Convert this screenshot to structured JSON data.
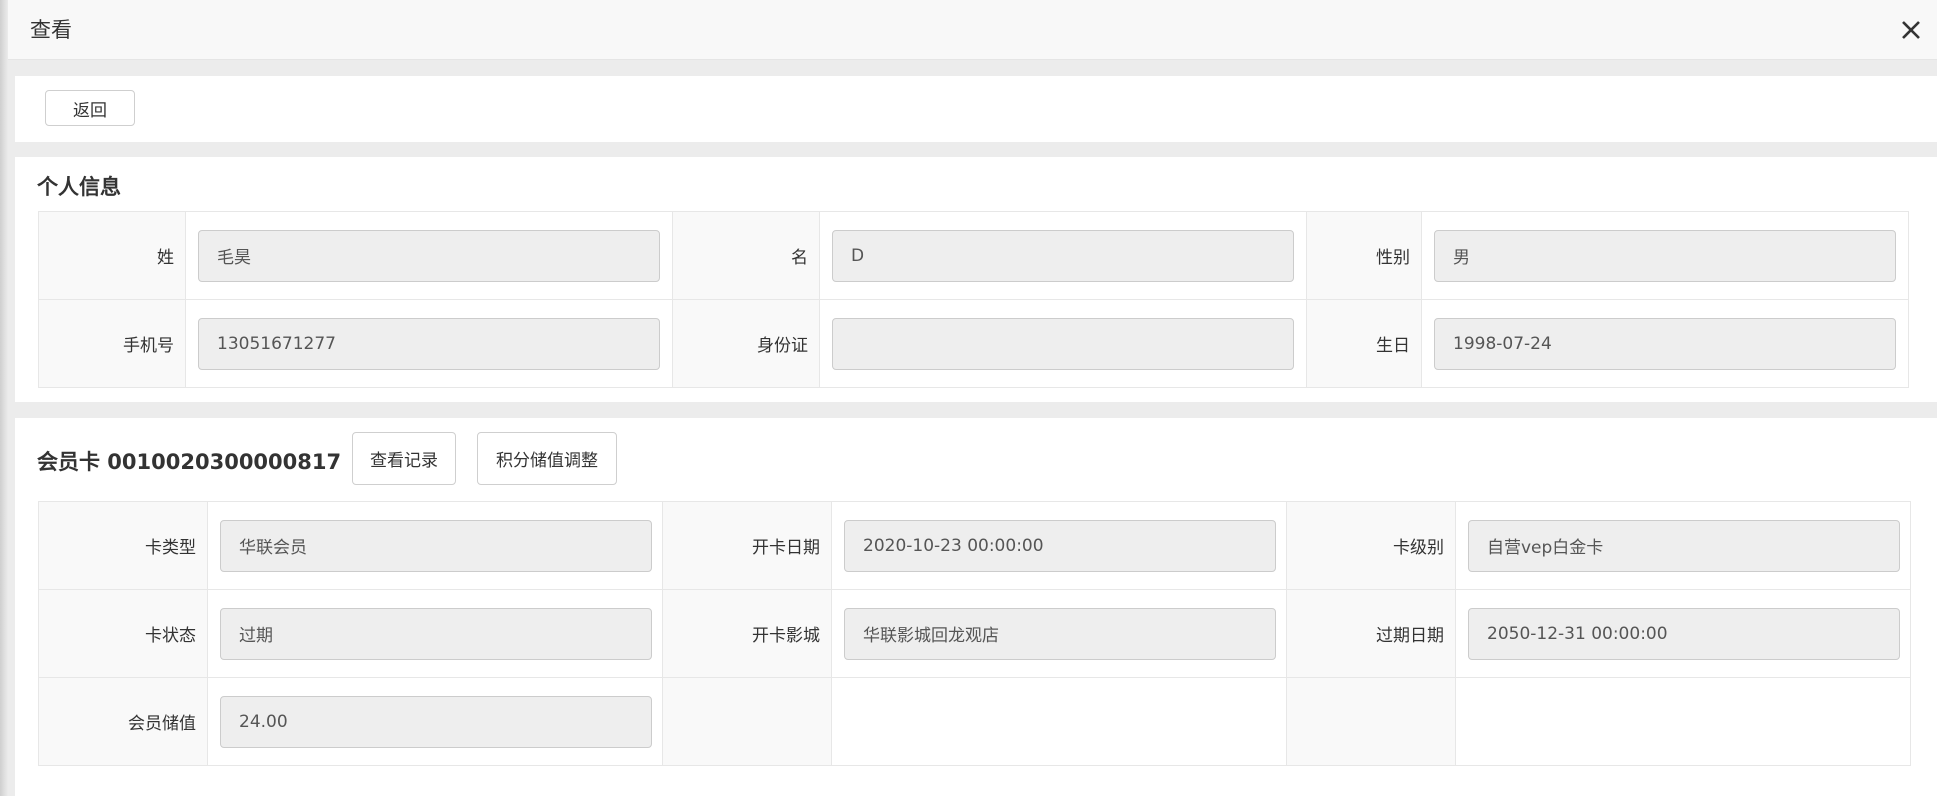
{
  "dialog": {
    "title": "查看"
  },
  "toolbar": {
    "back_label": "返回"
  },
  "personal": {
    "title": "个人信息",
    "fields": {
      "surname": {
        "label": "姓",
        "value": "毛昊"
      },
      "given_name": {
        "label": "名",
        "value": "D"
      },
      "gender": {
        "label": "性别",
        "value": "男"
      },
      "phone": {
        "label": "手机号",
        "value": "13051671277"
      },
      "id_card": {
        "label": "身份证",
        "value": ""
      },
      "birthday": {
        "label": "生日",
        "value": "1998-07-24"
      }
    }
  },
  "card": {
    "title": "会员卡 0010020300000817",
    "records_label": "查看记录",
    "adjust_label": "积分储值调整",
    "fields": {
      "card_type": {
        "label": "卡类型",
        "value": "华联会员"
      },
      "open_date": {
        "label": "开卡日期",
        "value": "2020-10-23 00:00:00"
      },
      "card_level": {
        "label": "卡级别",
        "value": "自营vep白金卡"
      },
      "card_status": {
        "label": "卡状态",
        "value": "过期"
      },
      "open_cinema": {
        "label": "开卡影城",
        "value": "华联影城回龙观店"
      },
      "expire_date": {
        "label": "过期日期",
        "value": "2050-12-31 00:00:00"
      },
      "stored_value": {
        "label": "会员储值",
        "value": "24.00"
      }
    }
  }
}
